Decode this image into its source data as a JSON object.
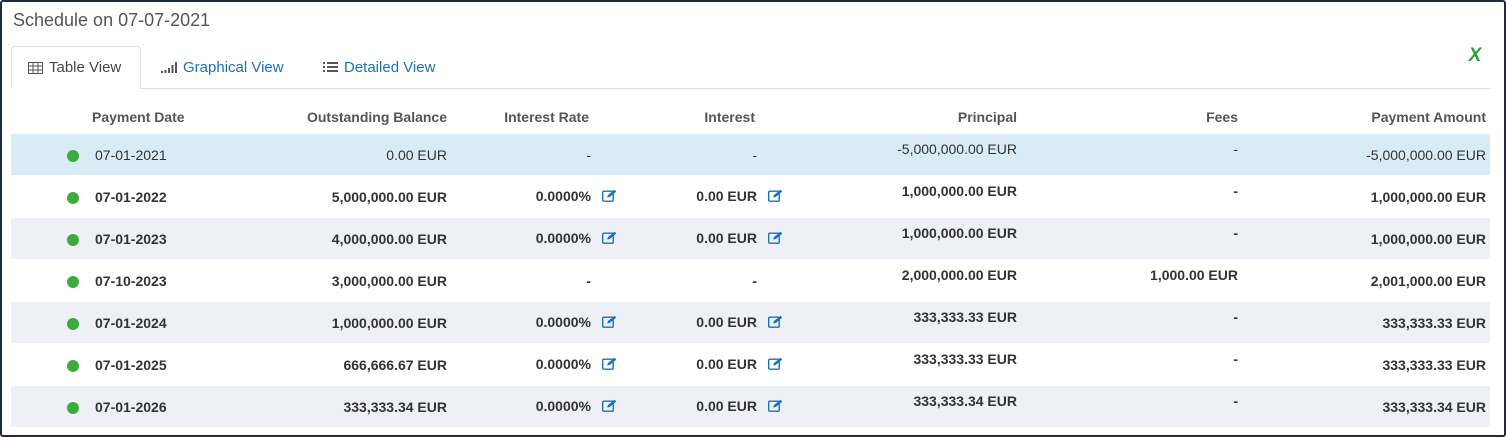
{
  "title": "Schedule on 07-07-2021",
  "tabs": [
    {
      "label": "Table View",
      "icon": "table-icon",
      "active": true
    },
    {
      "label": "Graphical View",
      "icon": "bar-chart-icon",
      "active": false
    },
    {
      "label": "Detailed View",
      "icon": "list-icon",
      "active": false
    }
  ],
  "export_icon": "excel-icon",
  "export_glyph": "X",
  "columns": {
    "payment_date": "Payment Date",
    "outstanding_balance": "Outstanding Balance",
    "interest_rate": "Interest Rate",
    "interest": "Interest",
    "principal": "Principal",
    "fees": "Fees",
    "payment_amount": "Payment Amount"
  },
  "rows": [
    {
      "date": "07-01-2021",
      "balance": "0.00 EUR",
      "rate": "-",
      "interest": "-",
      "principal": "-5,000,000.00 EUR",
      "fees": "-",
      "payment": "-5,000,000.00 EUR"
    },
    {
      "date": "07-01-2022",
      "balance": "5,000,000.00 EUR",
      "rate": "0.0000%",
      "interest": "0.00 EUR",
      "principal": "1,000,000.00 EUR",
      "fees": "-",
      "payment": "1,000,000.00 EUR"
    },
    {
      "date": "07-01-2023",
      "balance": "4,000,000.00 EUR",
      "rate": "0.0000%",
      "interest": "0.00 EUR",
      "principal": "1,000,000.00 EUR",
      "fees": "-",
      "payment": "1,000,000.00 EUR"
    },
    {
      "date": "07-10-2023",
      "balance": "3,000,000.00 EUR",
      "rate": "-",
      "interest": "-",
      "principal": "2,000,000.00 EUR",
      "fees": "1,000.00 EUR",
      "payment": "2,001,000.00 EUR"
    },
    {
      "date": "07-01-2024",
      "balance": "1,000,000.00 EUR",
      "rate": "0.0000%",
      "interest": "0.00 EUR",
      "principal": "333,333.33 EUR",
      "fees": "-",
      "payment": "333,333.33 EUR"
    },
    {
      "date": "07-01-2025",
      "balance": "666,666.67 EUR",
      "rate": "0.0000%",
      "interest": "0.00 EUR",
      "principal": "333,333.33 EUR",
      "fees": "-",
      "payment": "333,333.33 EUR"
    },
    {
      "date": "07-01-2026",
      "balance": "333,333.34 EUR",
      "rate": "0.0000%",
      "interest": "0.00 EUR",
      "principal": "333,333.34 EUR",
      "fees": "-",
      "payment": "333,333.34 EUR"
    }
  ],
  "colors": {
    "accent": "#1a73b9",
    "status_dot": "#3cab3c",
    "highlight_row": "#d9ebf5",
    "alt_row": "#eef0f6",
    "excel": "#2e9e3a"
  }
}
